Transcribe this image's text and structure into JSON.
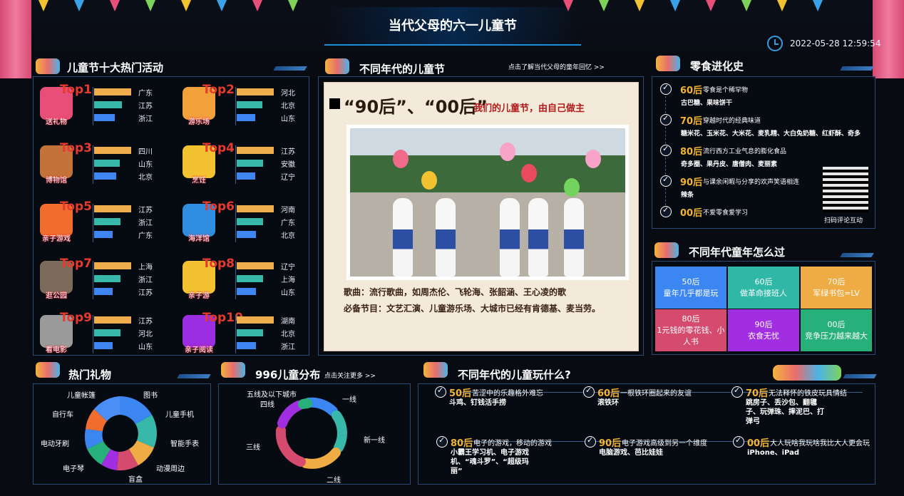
{
  "header": {
    "title": "当代父母的六一儿童节",
    "datetime": "2022-05-28 12:59:54"
  },
  "left_panel": {
    "title": "儿童节十大热门活动",
    "items": [
      {
        "rank": "Top1",
        "name": "送礼物",
        "provinces": [
          "广东",
          "江苏",
          "浙江"
        ],
        "bar_colors": [
          "#f0ad4e",
          "#37b8a8",
          "#3f86f2"
        ],
        "bar_fracs": [
          1.0,
          0.75,
          0.55
        ]
      },
      {
        "rank": "Top2",
        "name": "游乐场",
        "provinces": [
          "河北",
          "北京",
          "山东"
        ],
        "bar_colors": [
          "#f0ad4e",
          "#37b8a8",
          "#3f86f2"
        ],
        "bar_fracs": [
          1.0,
          0.7,
          0.5
        ]
      },
      {
        "rank": "Top3",
        "name": "博物馆",
        "provinces": [
          "四川",
          "山东",
          "北京"
        ],
        "bar_colors": [
          "#f0ad4e",
          "#37b8a8",
          "#3f86f2"
        ],
        "bar_fracs": [
          1.0,
          0.7,
          0.6
        ]
      },
      {
        "rank": "Top4",
        "name": "烹饪",
        "provinces": [
          "江苏",
          "安徽",
          "辽宁"
        ],
        "bar_colors": [
          "#f0ad4e",
          "#37b8a8",
          "#3f86f2"
        ],
        "bar_fracs": [
          1.0,
          0.72,
          0.5
        ]
      },
      {
        "rank": "Top5",
        "name": "亲子游戏",
        "provinces": [
          "江苏",
          "浙江",
          "广东"
        ],
        "bar_colors": [
          "#f0ad4e",
          "#37b8a8",
          "#3f86f2"
        ],
        "bar_fracs": [
          1.0,
          0.72,
          0.5
        ]
      },
      {
        "rank": "Top6",
        "name": "海洋馆",
        "provinces": [
          "河南",
          "广东",
          "北京"
        ],
        "bar_colors": [
          "#f0ad4e",
          "#37b8a8",
          "#3f86f2"
        ],
        "bar_fracs": [
          1.0,
          0.72,
          0.52
        ]
      },
      {
        "rank": "Top7",
        "name": "逛公园",
        "provinces": [
          "上海",
          "浙江",
          "江苏"
        ],
        "bar_colors": [
          "#f0ad4e",
          "#37b8a8",
          "#3f86f2"
        ],
        "bar_fracs": [
          1.0,
          0.72,
          0.5
        ]
      },
      {
        "rank": "Top8",
        "name": "亲子游",
        "provinces": [
          "辽宁",
          "上海",
          "山东"
        ],
        "bar_colors": [
          "#f0ad4e",
          "#37b8a8",
          "#3f86f2"
        ],
        "bar_fracs": [
          1.0,
          0.72,
          0.52
        ]
      },
      {
        "rank": "Top9",
        "name": "看电影",
        "provinces": [
          "江苏",
          "河北",
          "山东"
        ],
        "bar_colors": [
          "#f0ad4e",
          "#37b8a8",
          "#3f86f2"
        ],
        "bar_fracs": [
          1.0,
          0.72,
          0.5
        ]
      },
      {
        "rank": "Top10",
        "name": "亲子阅读",
        "provinces": [
          "湖南",
          "北京",
          "浙江"
        ],
        "bar_colors": [
          "#f0ad4e",
          "#37b8a8",
          "#3f86f2"
        ],
        "bar_fracs": [
          1.0,
          0.72,
          0.52
        ]
      }
    ]
  },
  "center_panel": {
    "title": "不同年代的儿童节",
    "link": "点击了解当代父母的童年回忆 >>",
    "headline": "“90后”、“00后”",
    "headline2": "我们的儿童节，由自己做主",
    "song": "歌曲：流行歌曲，如周杰伦、飞轮海、张韶涵、王心凌的歌",
    "program": "必备节目：文艺汇演、儿童游乐场、大城市已经有肯德基、麦当劳。"
  },
  "snack_panel": {
    "title": "零食进化史",
    "qr_label": "扫码评论互动",
    "items": [
      {
        "year": "60后",
        "desc": "零食是个稀罕物",
        "items": "古巴糖、果味饼干"
      },
      {
        "year": "70后",
        "desc": "穿越时代的经典味道",
        "items": "糖米花、玉米花、大米花、麦乳精、大白兔奶糖、红虾酥、奇多"
      },
      {
        "year": "80后",
        "desc": "流行西方工业气息的膨化食品",
        "items": "奇多圈、果丹皮、唐僧肉、麦丽素"
      },
      {
        "year": "90后",
        "desc": "与课余闲暇与分享的欢声笑语相连",
        "items": "辣条"
      },
      {
        "year": "00后",
        "desc": "不爱零食爱学习",
        "items": ""
      }
    ]
  },
  "childhood_panel": {
    "title": "不同年代童年怎么过",
    "tiles": [
      {
        "year": "50后",
        "text": "童年几乎都是玩",
        "color": "#3b86f0"
      },
      {
        "year": "60后",
        "text": "做革命接班人",
        "color": "#2fb8a6"
      },
      {
        "year": "70后",
        "text": "军绿书包=LV",
        "color": "#efac45"
      },
      {
        "year": "80后",
        "text": "1元钱的零花钱、小人书",
        "color": "#d54b6e"
      },
      {
        "year": "90后",
        "text": "衣食无忧",
        "color": "#a12ee0"
      },
      {
        "year": "00后",
        "text": "竞争压力越来越大",
        "color": "#27b07a"
      }
    ]
  },
  "gift_panel": {
    "title": "热门礼物",
    "labels": [
      "儿童帐篷",
      "图书",
      "儿童手机",
      "自行车",
      "智能手表",
      "电动牙刷",
      "动漫周边",
      "电子琴",
      "盲盒"
    ]
  },
  "distribution_panel": {
    "title": "996儿童分布",
    "link": "点击关注更多 >>",
    "labels": [
      "五线及以下城市",
      "一线",
      "四线",
      "新一线",
      "三线",
      "二线"
    ]
  },
  "play_panel": {
    "title": "不同年代的儿童玩什么?",
    "items": [
      {
        "year": "50后",
        "desc": "苦涩中的乐趣格外难忘",
        "detail": "斗鸡、钉钱活手捞"
      },
      {
        "year": "60后",
        "desc": "一根铁环圈起来的友谊",
        "detail": "滚铁环"
      },
      {
        "year": "70后",
        "desc": "无法释怀的铁皮玩具情结",
        "detail": "跳房子、丢沙包、翻毽子、玩弹珠、摔泥巴、打弹弓"
      },
      {
        "year": "80后",
        "desc": "电子的游戏，移动的游戏",
        "detail": "小霸王学习机、电子游戏机、“魂斗罗”、“超级玛丽”"
      },
      {
        "year": "90后",
        "desc": "电子游戏高级到另一个维度",
        "detail": "电脑游戏、芭比娃娃"
      },
      {
        "year": "00后",
        "desc": "大人玩啥我玩啥我比大人更会玩",
        "detail": "iPhone、iPad"
      }
    ]
  }
}
